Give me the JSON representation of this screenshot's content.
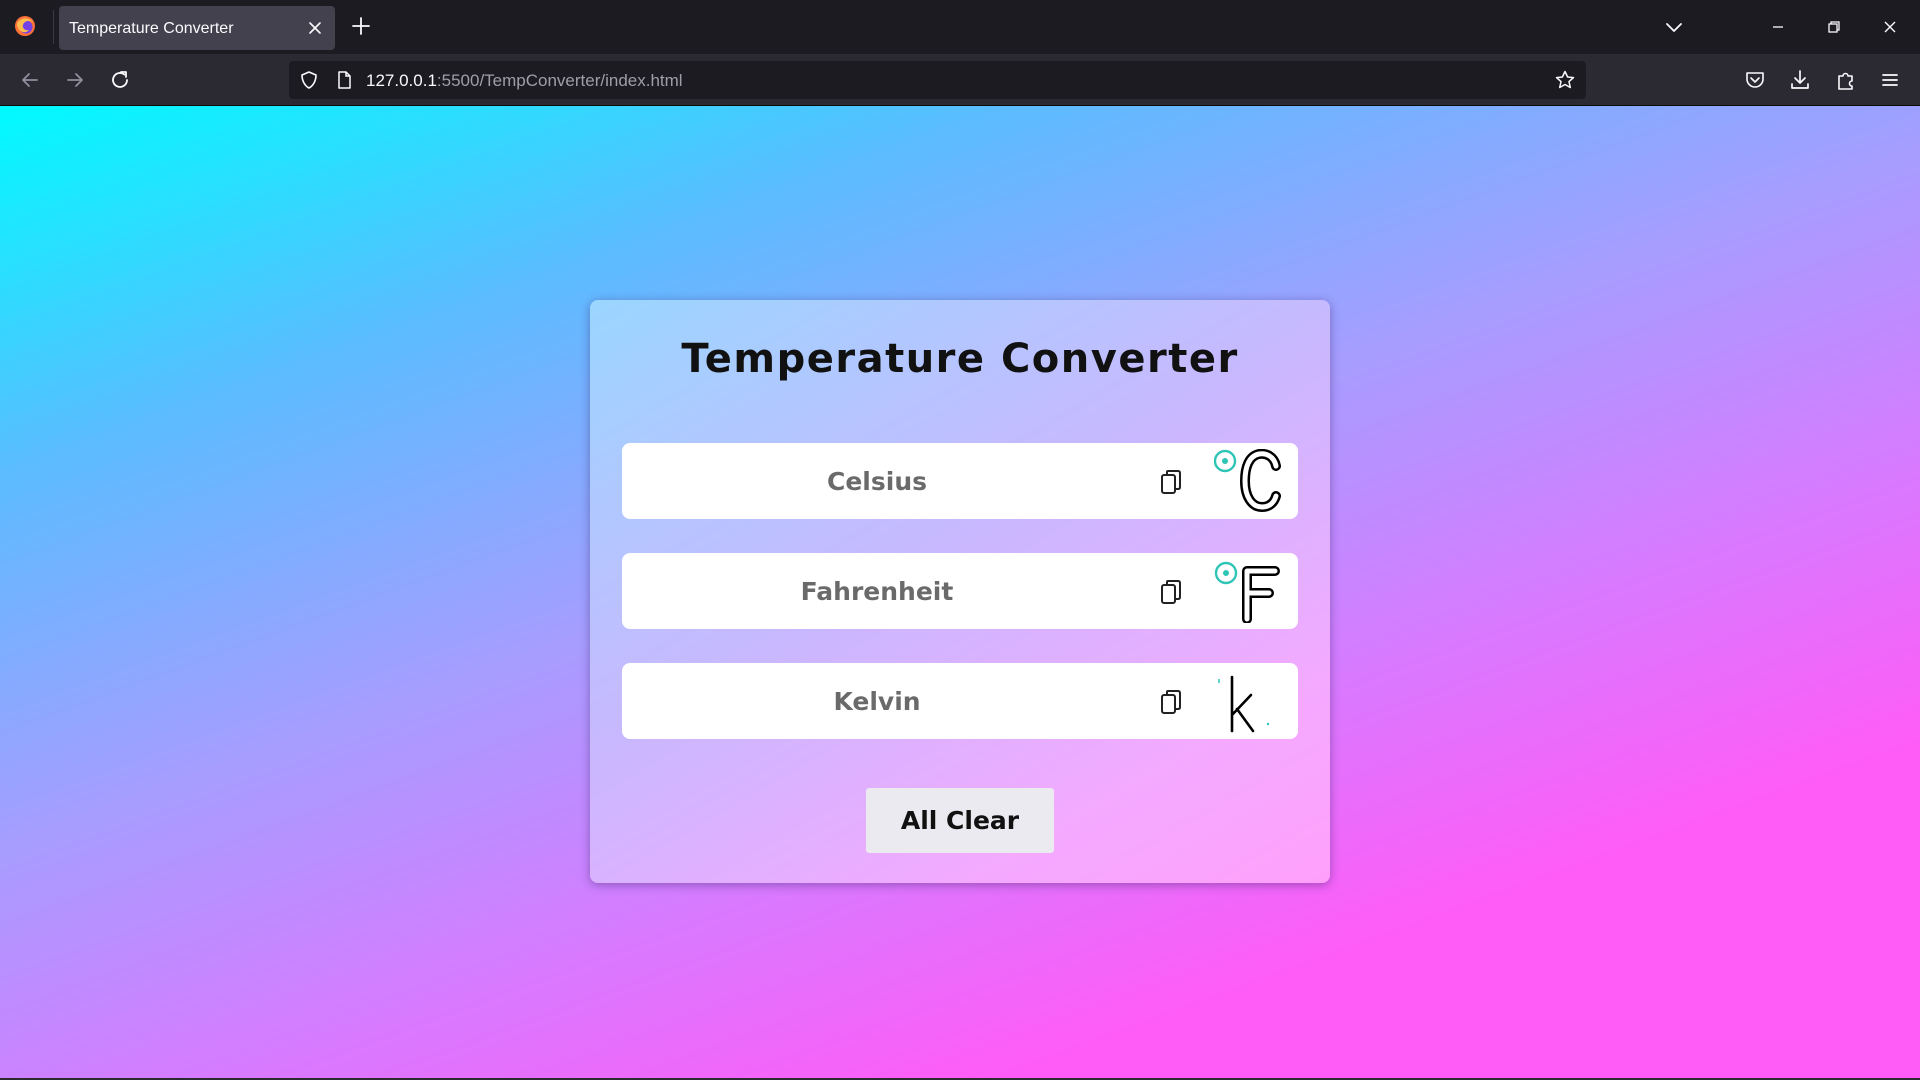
{
  "browser": {
    "tab_title": "Temperature Converter",
    "url_host": "127.0.0.1",
    "url_path": ":5500/TempConverter/index.html"
  },
  "converter": {
    "title": "Temperature Converter",
    "fields": [
      {
        "placeholder": "Celsius",
        "value": "",
        "unit_icon": "degree-celsius-icon"
      },
      {
        "placeholder": "Fahrenheit",
        "value": "",
        "unit_icon": "degree-fahrenheit-icon"
      },
      {
        "placeholder": "Kelvin",
        "value": "",
        "unit_icon": "kelvin-icon"
      }
    ],
    "clear_label": "All Clear"
  },
  "colors": {
    "gradient_start": "#00fbff",
    "gradient_end": "#ff5cf7",
    "unit_accent": "#2ec4b6"
  }
}
